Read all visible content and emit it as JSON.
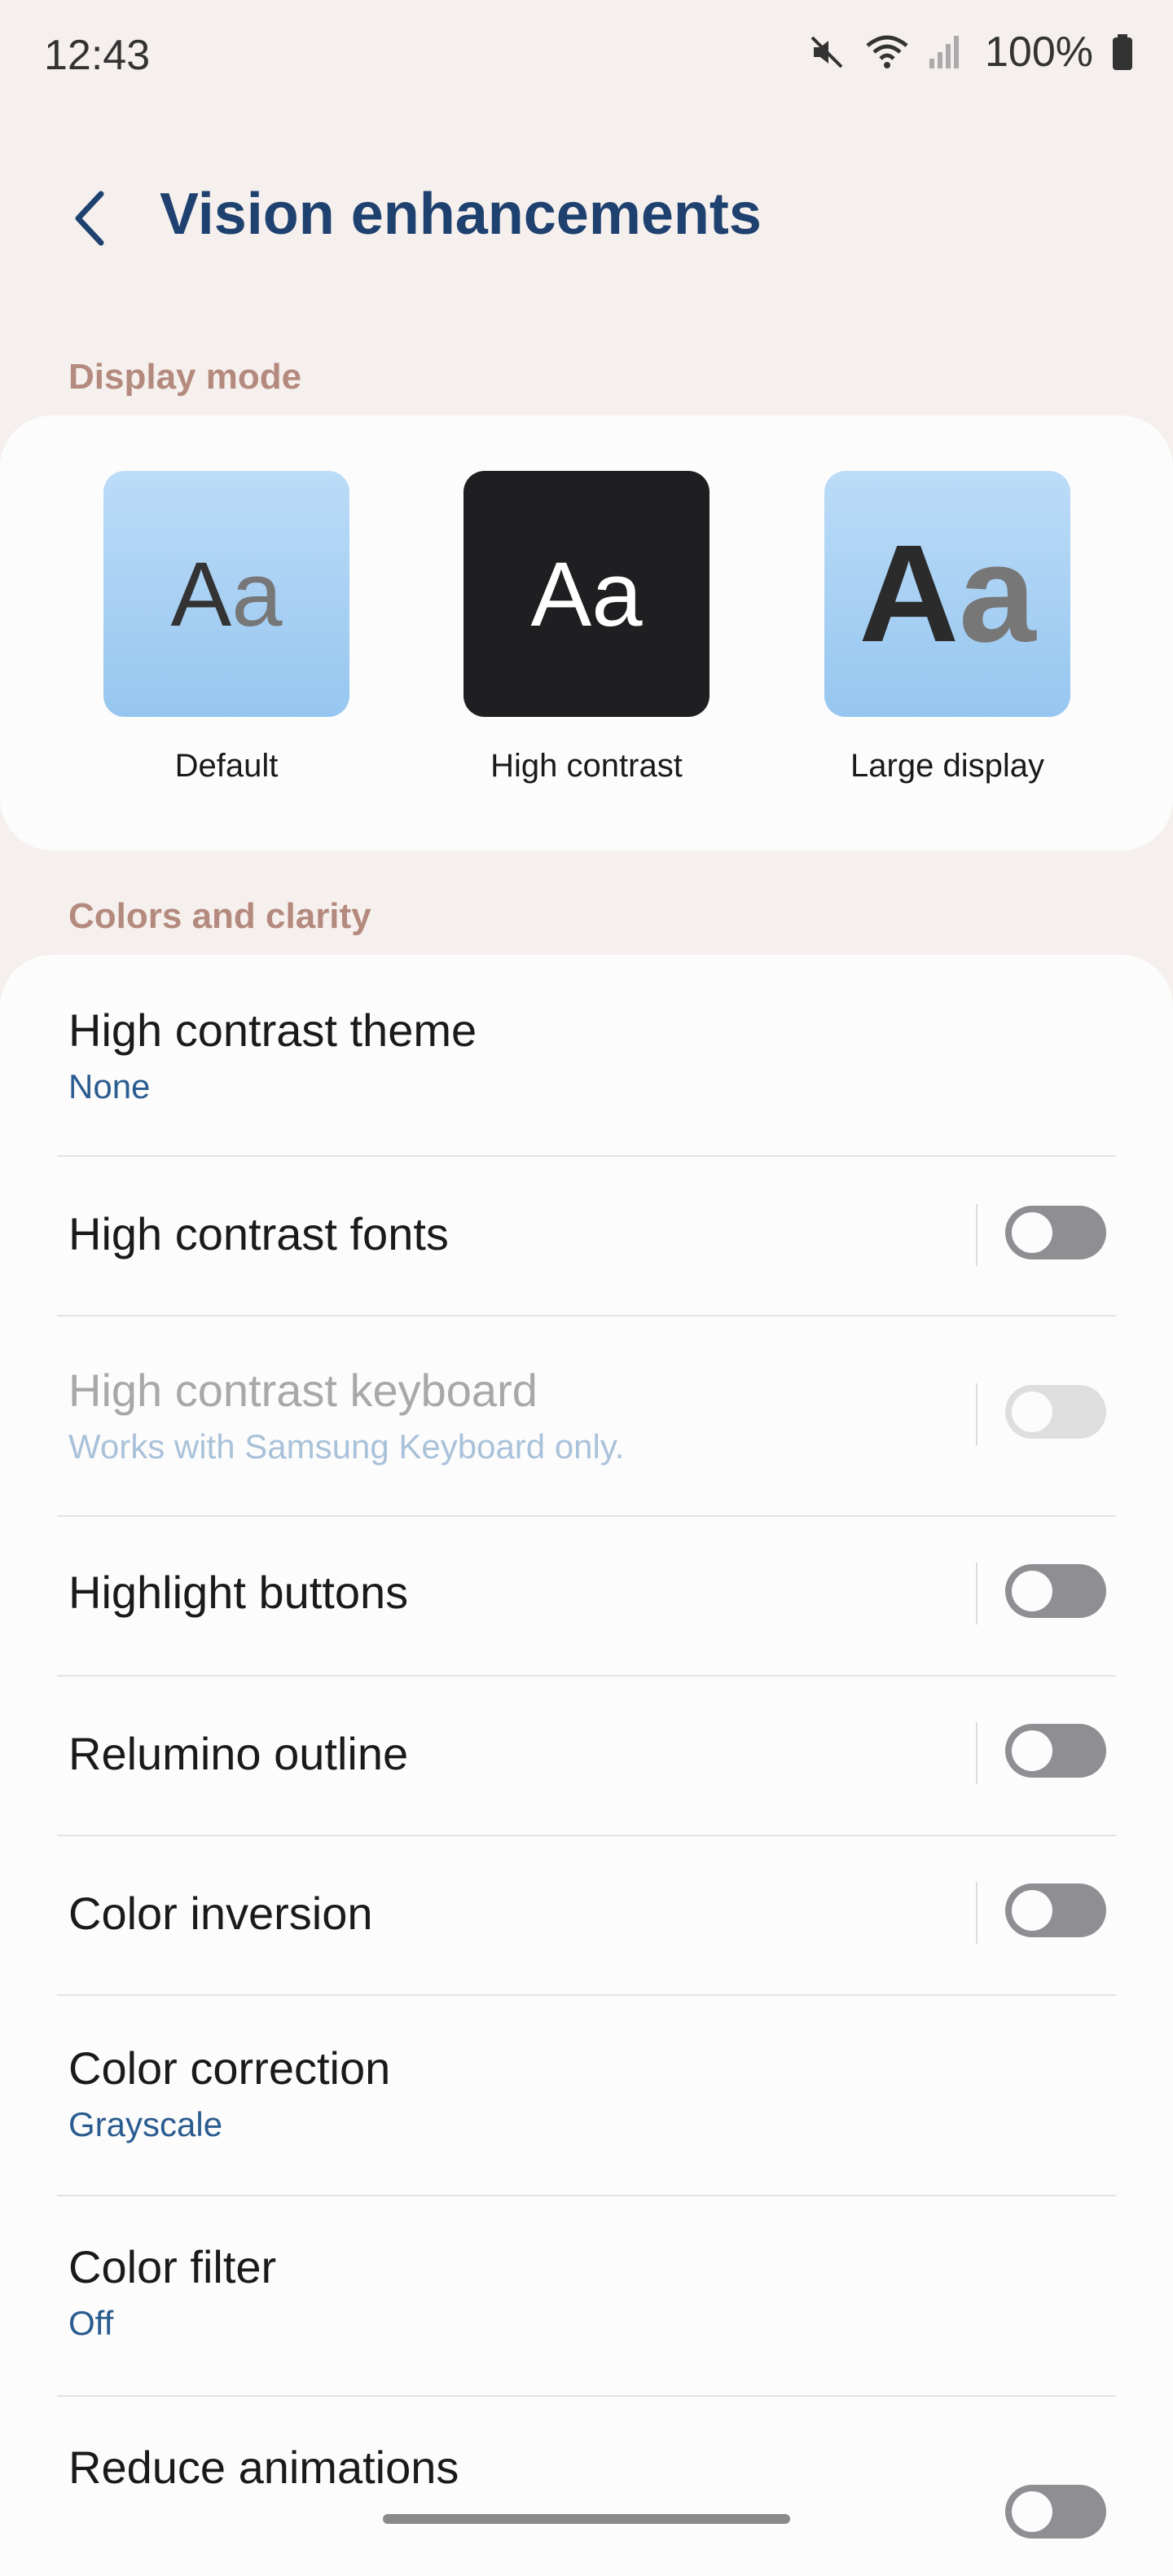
{
  "status": {
    "time": "12:43",
    "battery": "100%",
    "icons": [
      "mute-icon",
      "wifi-icon",
      "signal-icon",
      "battery-icon"
    ]
  },
  "header": {
    "back_icon": "chevron-left-icon",
    "title": "Vision enhancements"
  },
  "display_mode": {
    "section_label": "Display mode",
    "modes": [
      {
        "sample": [
          "A",
          "a"
        ],
        "label": "Default"
      },
      {
        "sample": [
          "A",
          "a"
        ],
        "label": "High contrast"
      },
      {
        "sample": [
          "A",
          "a"
        ],
        "label": "Large display"
      }
    ]
  },
  "colors_clarity": {
    "section_label": "Colors and clarity",
    "items": [
      {
        "label": "High contrast theme",
        "sub": "None"
      },
      {
        "label": "High contrast fonts",
        "toggle": false
      },
      {
        "label": "High contrast keyboard",
        "sub": "Works with Samsung Keyboard only.",
        "toggle": false,
        "disabled": true
      },
      {
        "label": "Highlight buttons",
        "toggle": false
      },
      {
        "label": "Relumino outline",
        "toggle": false
      },
      {
        "label": "Color inversion",
        "toggle": false
      },
      {
        "label": "Color correction",
        "sub": "Grayscale"
      },
      {
        "label": "Color filter",
        "sub": "Off"
      },
      {
        "label": "Reduce animations",
        "toggle": false
      }
    ]
  },
  "colors": {
    "title": "#1f4170",
    "section_label": "#b58a7e",
    "summary": "#2b5c8f",
    "toggle_off": "#8e8e93"
  }
}
